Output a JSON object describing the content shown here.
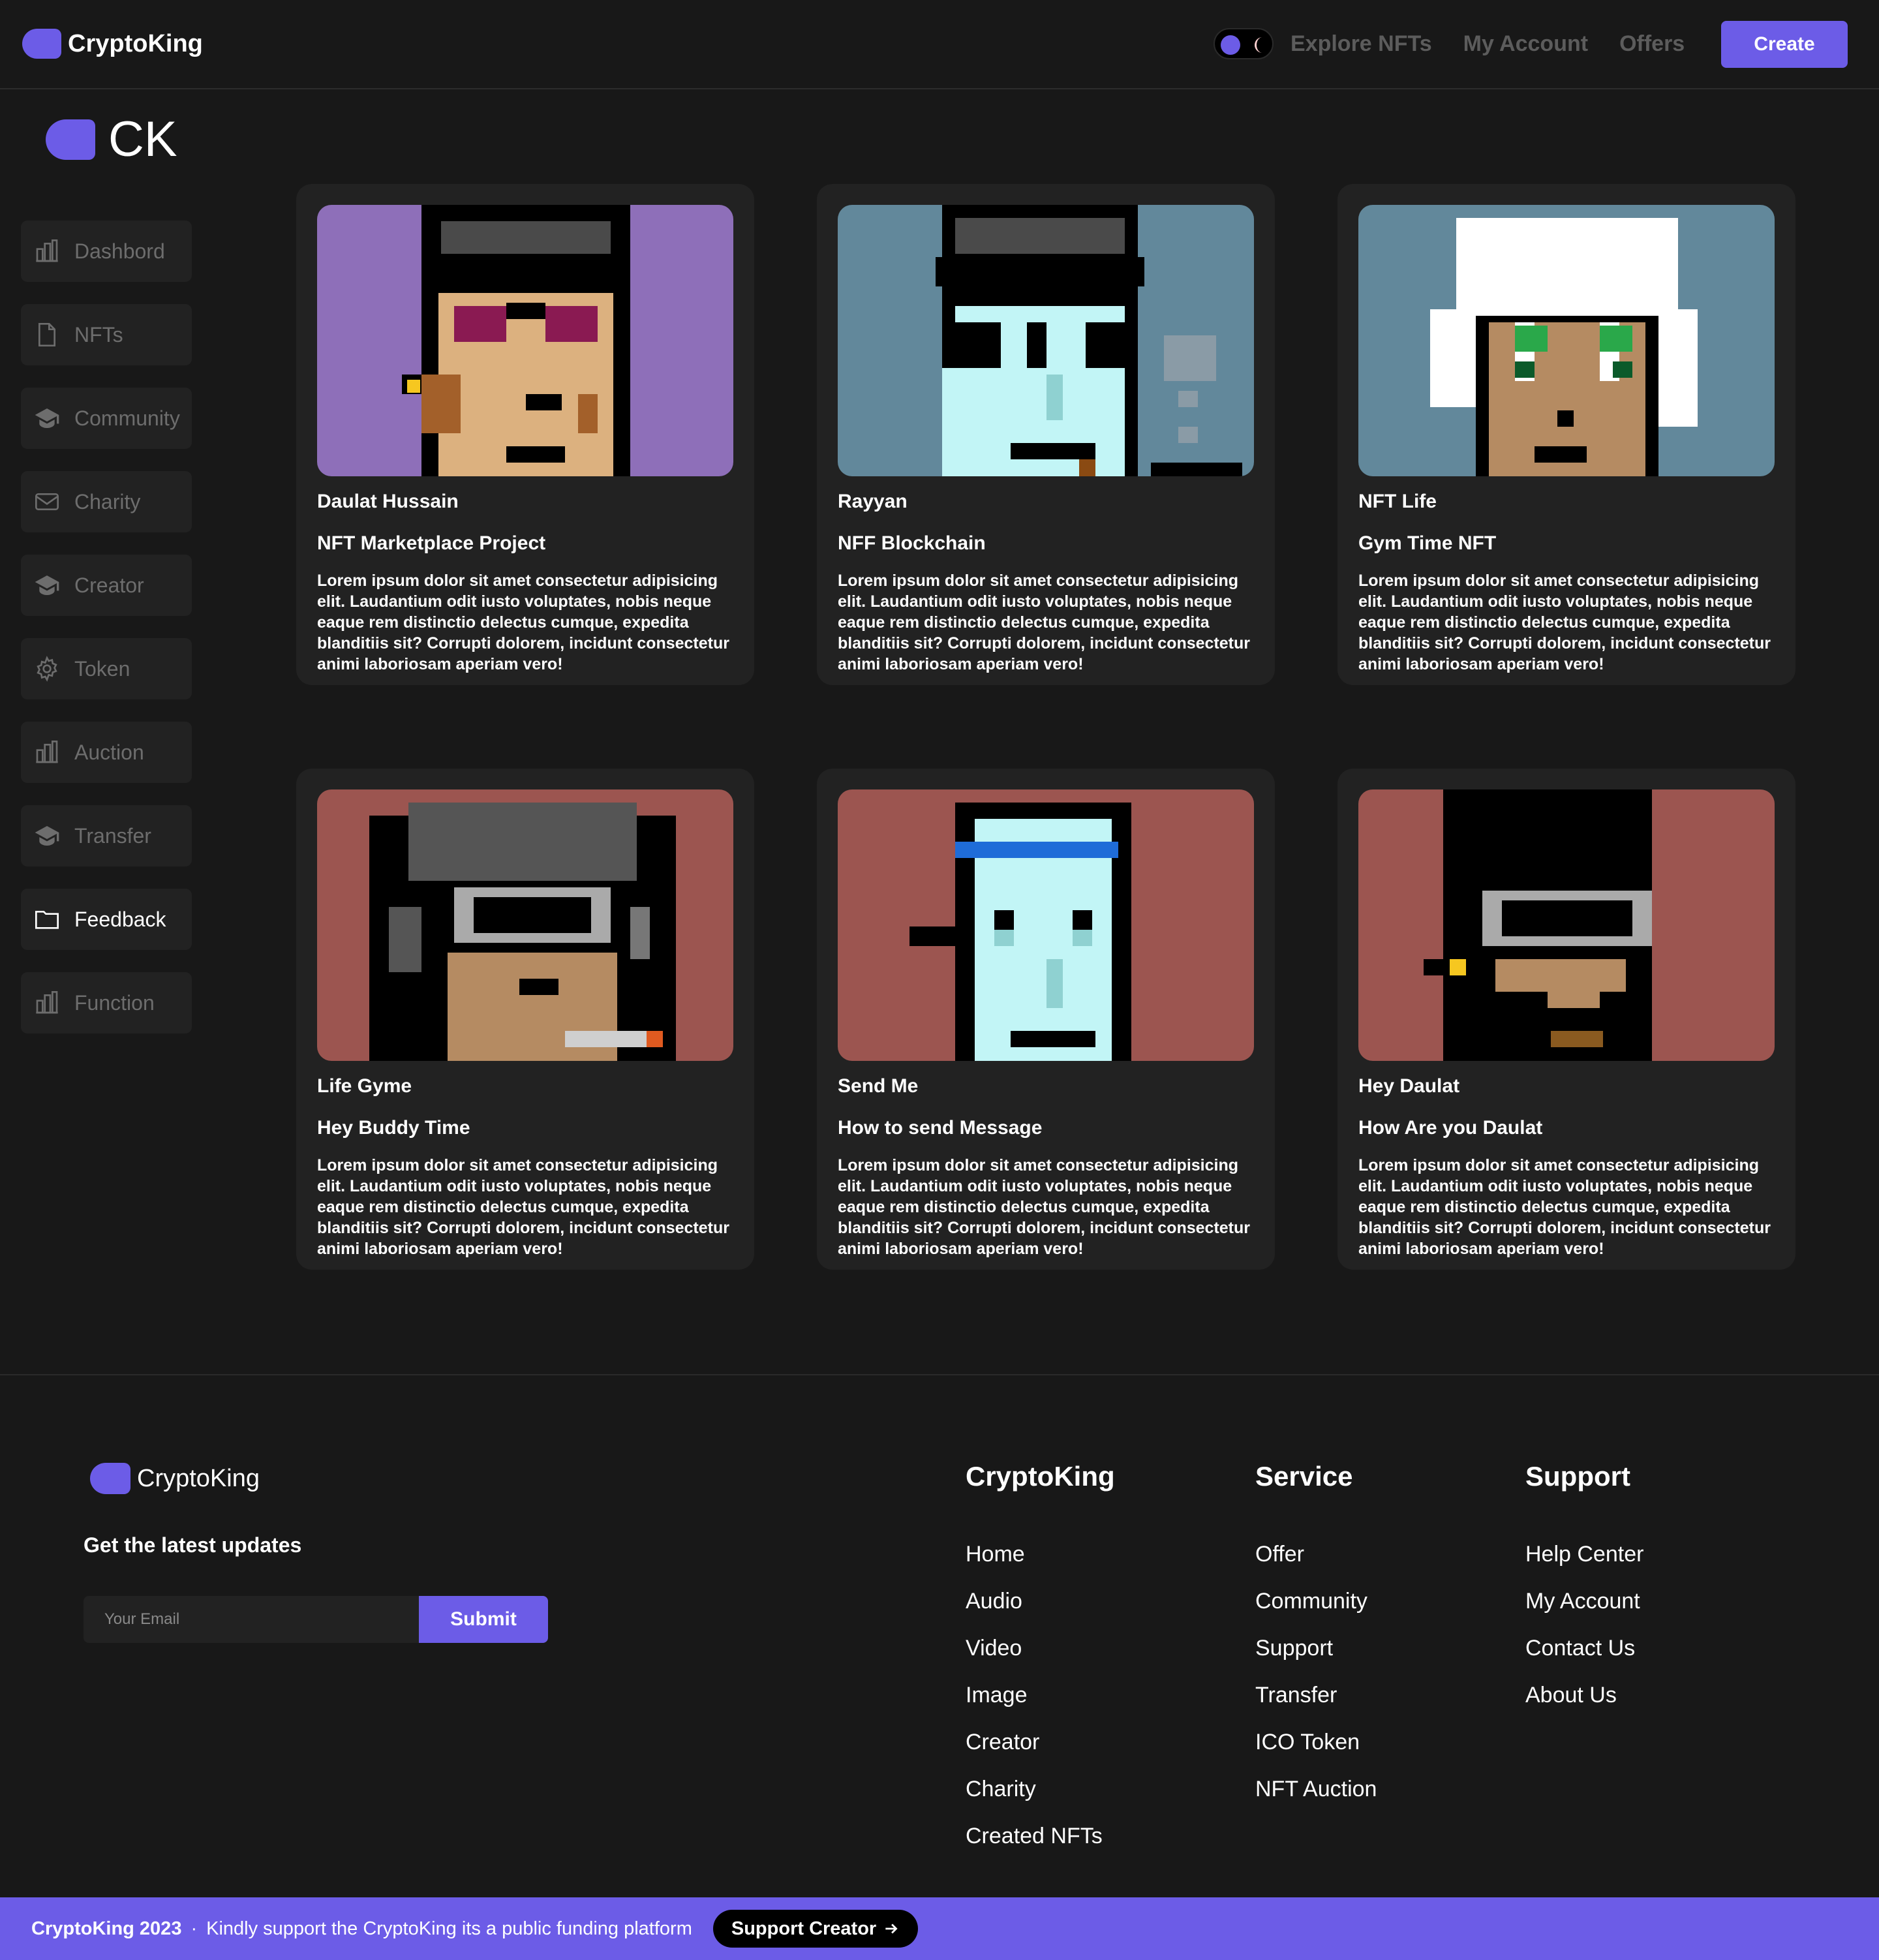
{
  "colors": {
    "accent": "#6c5ce7",
    "background": "#181818",
    "card": "#222222",
    "muted": "#6d6d6d"
  },
  "header": {
    "brand": "CryptoKing",
    "nav": [
      "Explore NFTs",
      "My Account",
      "Offers"
    ],
    "create_label": "Create",
    "theme_toggle": {
      "icons": [
        "dot",
        "moon-icon"
      ]
    }
  },
  "sidebar": {
    "logo_text": "CK",
    "items": [
      {
        "label": "Dashbord",
        "icon": "chart-icon"
      },
      {
        "label": "NFTs",
        "icon": "file-icon"
      },
      {
        "label": "Community",
        "icon": "graduation-cap-icon"
      },
      {
        "label": "Charity",
        "icon": "mail-icon"
      },
      {
        "label": "Creator",
        "icon": "graduation-cap-icon"
      },
      {
        "label": "Token",
        "icon": "gear-icon"
      },
      {
        "label": "Auction",
        "icon": "chart-icon"
      },
      {
        "label": "Transfer",
        "icon": "graduation-cap-icon"
      },
      {
        "label": "Feedback",
        "icon": "folder-icon",
        "active": true
      },
      {
        "label": "Function",
        "icon": "chart-icon"
      }
    ]
  },
  "cards": [
    {
      "author": "Daulat Hussain",
      "title": "NFT Marketplace Project",
      "bg": "#8e6fb9",
      "description": "Lorem ipsum dolor sit amet consectetur adipisicing elit. Laudantium odit iusto voluptates, nobis neque eaque rem distinctio delectus cumque, expedita blanditiis sit? Corrupti dolorem, incidunt consectetur animi laboriosam aperiam vero!"
    },
    {
      "author": "Rayyan",
      "title": "NFF Blockchain",
      "bg": "#62889b",
      "description": "Lorem ipsum dolor sit amet consectetur adipisicing elit. Laudantium odit iusto voluptates, nobis neque eaque rem distinctio delectus cumque, expedita blanditiis sit? Corrupti dolorem, incidunt consectetur animi laboriosam aperiam vero!"
    },
    {
      "author": "NFT Life",
      "title": "Gym Time NFT",
      "bg": "#62889b",
      "description": "Lorem ipsum dolor sit amet consectetur adipisicing elit. Laudantium odit iusto voluptates, nobis neque eaque rem distinctio delectus cumque, expedita blanditiis sit? Corrupti dolorem, incidunt consectetur animi laboriosam aperiam vero!"
    },
    {
      "author": "Life Gyme",
      "title": "Hey Buddy Time",
      "bg": "#9c5550",
      "description": "Lorem ipsum dolor sit amet consectetur adipisicing elit. Laudantium odit iusto voluptates, nobis neque eaque rem distinctio delectus cumque, expedita blanditiis sit? Corrupti dolorem, incidunt consectetur animi laboriosam aperiam vero!"
    },
    {
      "author": "Send Me",
      "title": "How to send Message",
      "bg": "#9c5550",
      "description": "Lorem ipsum dolor sit amet consectetur adipisicing elit. Laudantium odit iusto voluptates, nobis neque eaque rem distinctio delectus cumque, expedita blanditiis sit? Corrupti dolorem, incidunt consectetur animi laboriosam aperiam vero!"
    },
    {
      "author": "Hey Daulat",
      "title": "How Are you Daulat",
      "bg": "#9c5550",
      "description": "Lorem ipsum dolor sit amet consectetur adipisicing elit. Laudantium odit iusto voluptates, nobis neque eaque rem distinctio delectus cumque, expedita blanditiis sit? Corrupti dolorem, incidunt consectetur animi laboriosam aperiam vero!"
    }
  ],
  "footer": {
    "brand": "CryptoKing",
    "updates_label": "Get the latest updates",
    "email_placeholder": "Your Email",
    "submit_label": "Submit",
    "columns": [
      {
        "title": "CryptoKing",
        "links": [
          "Home",
          "Audio",
          "Video",
          "Image",
          "Creator",
          "Charity",
          "Created NFTs"
        ]
      },
      {
        "title": "Service",
        "links": [
          "Offer",
          "Community",
          "Support",
          "Transfer",
          "ICO Token",
          "NFT Auction"
        ]
      },
      {
        "title": "Support",
        "links": [
          "Help Center",
          "My Account",
          "Contact Us",
          "About Us"
        ]
      }
    ]
  },
  "bottom_bar": {
    "copyright": "CryptoKing 2023",
    "separator": "·",
    "message": "Kindly support the CryptoKing its a public funding platform",
    "button_label": "Support Creator",
    "button_icon": "arrow-right-icon"
  }
}
